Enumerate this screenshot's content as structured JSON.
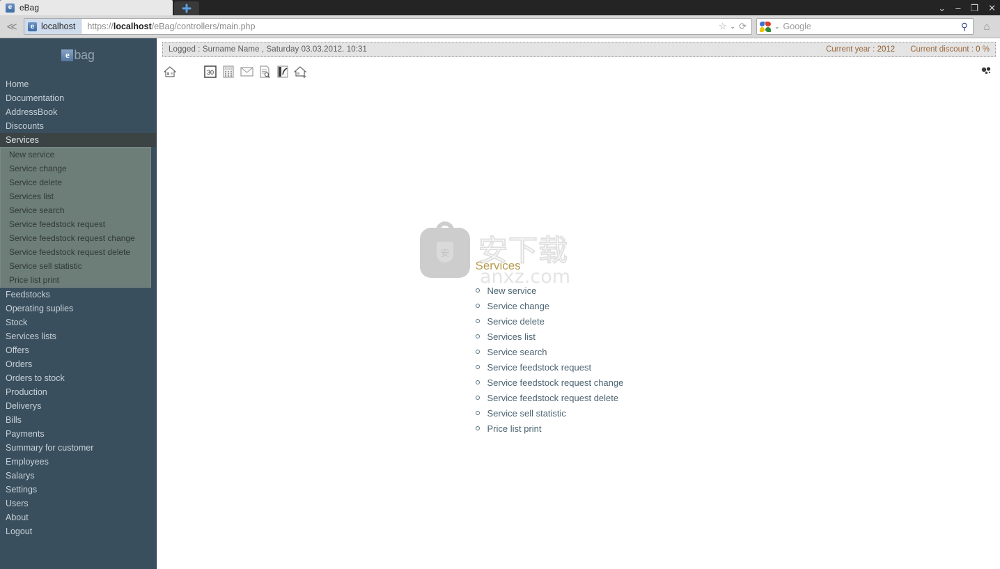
{
  "browser": {
    "tab": {
      "title": "eBag",
      "favicon": "e"
    },
    "new_tab_label": "+",
    "window_controls": {
      "chevron": "⌄",
      "minimize": "–",
      "maximize": "❐",
      "close": "✕"
    },
    "nav": {
      "back_forward": "≪"
    },
    "url": {
      "site_chip_favicon": "e",
      "site_chip_host": "localhost",
      "scheme": "https://",
      "host": "localhost",
      "path": "/eBag/controllers/main.php",
      "full": "https://localhost/eBag/controllers/main.php"
    },
    "url_actions": {
      "bookmark": "☆",
      "caret": "⌄",
      "reload": "⟳"
    },
    "search": {
      "engine": "Google",
      "placeholder": "Google",
      "caret": "⌄",
      "magnifier": "⚲"
    },
    "home_button": "⌂"
  },
  "sidebar": {
    "logo": {
      "mark": "e",
      "word": "bag"
    },
    "items": [
      {
        "label": "Home"
      },
      {
        "label": "Documentation"
      },
      {
        "label": "AddressBook"
      },
      {
        "label": "Discounts"
      },
      {
        "label": "Services",
        "active": true
      },
      {
        "label": "Feedstocks"
      },
      {
        "label": "Operating suplies"
      },
      {
        "label": "Stock"
      },
      {
        "label": "Services lists"
      },
      {
        "label": "Offers"
      },
      {
        "label": "Orders"
      },
      {
        "label": "Orders to stock"
      },
      {
        "label": "Production"
      },
      {
        "label": "Deliverys"
      },
      {
        "label": "Bills"
      },
      {
        "label": "Payments"
      },
      {
        "label": "Summary for customer"
      },
      {
        "label": "Employees"
      },
      {
        "label": "Salarys"
      },
      {
        "label": "Settings"
      },
      {
        "label": "Users"
      },
      {
        "label": "About"
      },
      {
        "label": "Logout"
      }
    ],
    "submenu": [
      {
        "label": "New service"
      },
      {
        "label": "Service change"
      },
      {
        "label": "Service delete"
      },
      {
        "label": "Services list"
      },
      {
        "label": "Service search"
      },
      {
        "label": "Service feedstock request"
      },
      {
        "label": "Service feedstock request change"
      },
      {
        "label": "Service feedstock request delete"
      },
      {
        "label": "Service sell statistic"
      },
      {
        "label": "Price list print"
      }
    ]
  },
  "info_bar": {
    "logged_text": "Logged :  Surname Name  ,  Saturday 03.03.2012. 10:31",
    "current_year_label": "Current year :",
    "current_year_value": "2012",
    "current_discount_label": "Current discount :",
    "current_discount_value": "0",
    "percent": "%",
    "accent_color": "#9c6a3f"
  },
  "toolbar": {
    "icons": [
      {
        "name": "home-icon",
        "glyph": "⌂"
      },
      {
        "name": "calendar-icon",
        "glyph": "30"
      },
      {
        "name": "calculator-icon",
        "glyph": "☷"
      },
      {
        "name": "mail-icon",
        "glyph": "✉"
      },
      {
        "name": "document-icon",
        "glyph": "☰"
      },
      {
        "name": "chart-icon",
        "glyph": "↗"
      },
      {
        "name": "home-add-icon",
        "glyph": "⌂"
      }
    ],
    "settings_icon": "⚙"
  },
  "main": {
    "title": "Services",
    "title_color": "#b69b4e",
    "links": [
      {
        "label": "New service"
      },
      {
        "label": "Service change"
      },
      {
        "label": "Service delete"
      },
      {
        "label": "Services list"
      },
      {
        "label": "Service search"
      },
      {
        "label": "Service feedstock request"
      },
      {
        "label": "Service feedstock request change"
      },
      {
        "label": "Service feedstock request delete"
      },
      {
        "label": "Service sell statistic"
      },
      {
        "label": "Price list print"
      }
    ]
  },
  "watermark": {
    "shield_glyph": "安",
    "chinese_text": "安下载",
    "site_text": "anxz.com"
  }
}
